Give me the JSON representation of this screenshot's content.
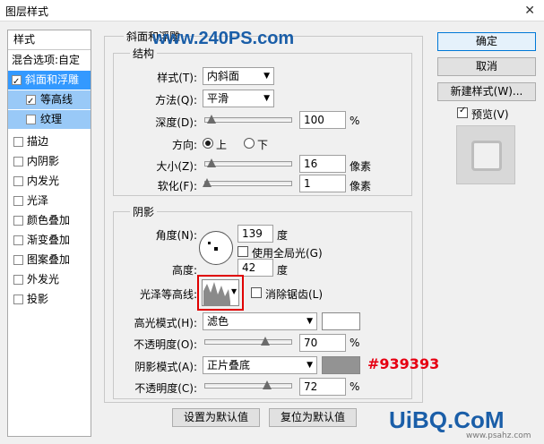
{
  "window": {
    "title": "图层样式"
  },
  "watermark": {
    "top": "www.240PS.com",
    "bottom": "UiBQ.CoM",
    "bottom_sub": "www.psahz.com"
  },
  "sidebar": {
    "header": "样式",
    "items": [
      {
        "label": "混合选项:自定",
        "checkbox": false,
        "checked": false,
        "state": "normal"
      },
      {
        "label": "斜面和浮雕",
        "checkbox": true,
        "checked": true,
        "state": "selected"
      },
      {
        "label": "等高线",
        "checkbox": true,
        "checked": true,
        "state": "sub-selected"
      },
      {
        "label": "纹理",
        "checkbox": true,
        "checked": false,
        "state": "sub"
      },
      {
        "label": "描边",
        "checkbox": true,
        "checked": false,
        "state": "normal"
      },
      {
        "label": "内阴影",
        "checkbox": true,
        "checked": false,
        "state": "normal"
      },
      {
        "label": "内发光",
        "checkbox": true,
        "checked": false,
        "state": "normal"
      },
      {
        "label": "光泽",
        "checkbox": true,
        "checked": false,
        "state": "normal"
      },
      {
        "label": "颜色叠加",
        "checkbox": true,
        "checked": false,
        "state": "normal"
      },
      {
        "label": "渐变叠加",
        "checkbox": true,
        "checked": false,
        "state": "normal"
      },
      {
        "label": "图案叠加",
        "checkbox": true,
        "checked": false,
        "state": "normal"
      },
      {
        "label": "外发光",
        "checkbox": true,
        "checked": false,
        "state": "normal"
      },
      {
        "label": "投影",
        "checkbox": true,
        "checked": false,
        "state": "normal"
      }
    ]
  },
  "bevel": {
    "group_title": "斜面和浮雕",
    "structure_title": "结构",
    "style_label": "样式(T):",
    "style_value": "内斜面",
    "technique_label": "方法(Q):",
    "technique_value": "平滑",
    "depth_label": "深度(D):",
    "depth_value": "100",
    "depth_unit": "%",
    "depth_pct": 0.07,
    "direction_label": "方向:",
    "dir_up": "上",
    "dir_down": "下",
    "size_label": "大小(Z):",
    "size_value": "16",
    "size_unit": "像素",
    "size_pct": 0.07,
    "soften_label": "软化(F):",
    "soften_value": "1",
    "soften_unit": "像素",
    "soften_pct": 0.02
  },
  "shading": {
    "title": "阴影",
    "angle_label": "角度(N):",
    "angle_value": "139",
    "angle_unit": "度",
    "global_light_label": "使用全局光(G)",
    "global_light_checked": false,
    "altitude_label": "高度:",
    "altitude_value": "42",
    "altitude_unit": "度",
    "gloss_label": "光泽等高线:",
    "anti_alias_label": "消除锯齿(L)",
    "anti_alias_checked": false,
    "highlight_mode_label": "高光模式(H):",
    "highlight_mode_value": "滤色",
    "highlight_color": "#ffffff",
    "highlight_opacity_label": "不透明度(O):",
    "highlight_opacity_value": "70",
    "highlight_opacity_unit": "%",
    "highlight_opacity_pct": 0.7,
    "shadow_mode_label": "阴影模式(A):",
    "shadow_mode_value": "正片叠底",
    "shadow_color": "#939393",
    "shadow_color_note": "#939393",
    "shadow_opacity_label": "不透明度(C):",
    "shadow_opacity_value": "72",
    "shadow_opacity_unit": "%",
    "shadow_opacity_pct": 0.72
  },
  "footer": {
    "make_default": "设置为默认值",
    "reset_default": "复位为默认值"
  },
  "right": {
    "ok": "确定",
    "cancel": "取消",
    "new_style": "新建样式(W)...",
    "preview_label": "预览(V)",
    "preview_checked": true
  },
  "colors": {
    "accent": "#3399ff",
    "note_red": "#e60012",
    "watermark_blue": "#1a5ea8",
    "highlight_box": "#e00000"
  }
}
